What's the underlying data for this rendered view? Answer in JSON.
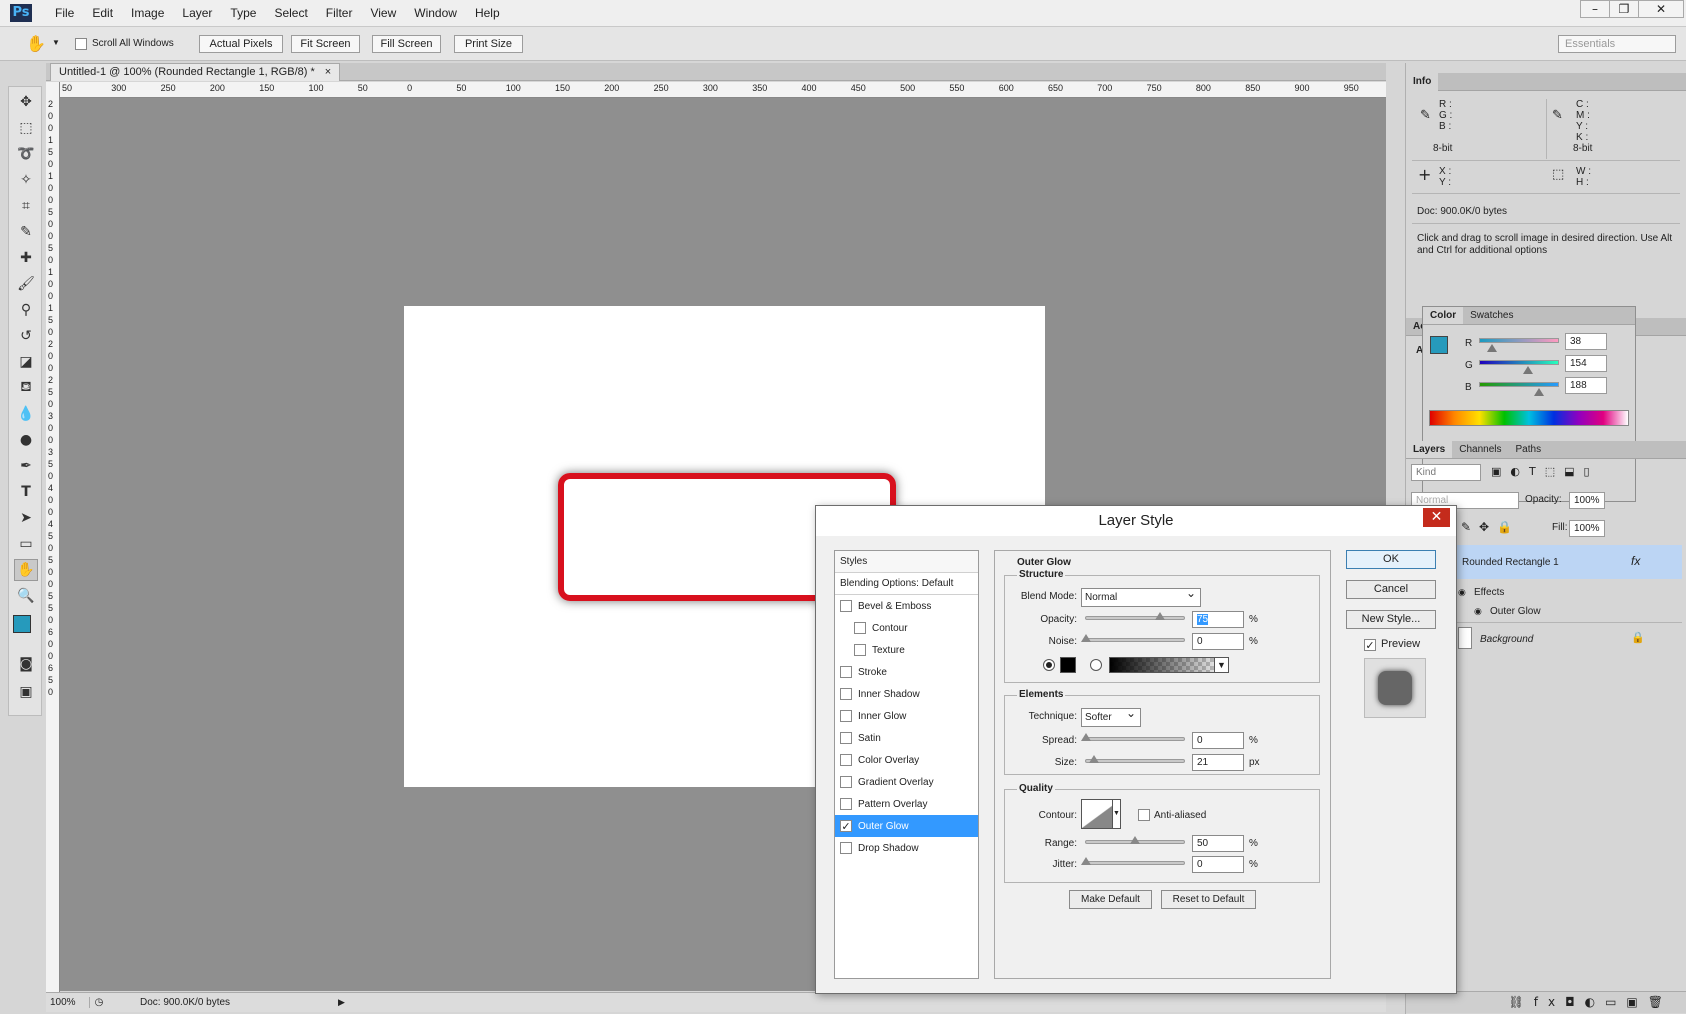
{
  "app": {
    "logo": "Ps"
  },
  "menu": [
    "File",
    "Edit",
    "Image",
    "Layer",
    "Type",
    "Select",
    "Filter",
    "View",
    "Window",
    "Help"
  ],
  "window_controls": {
    "minimize": "–",
    "restore": "❐",
    "close": "✕"
  },
  "options_bar": {
    "scroll_all_label": "Scroll All Windows",
    "buttons": [
      "Actual Pixels",
      "Fit Screen",
      "Fill Screen",
      "Print Size"
    ],
    "workspace": "Essentials"
  },
  "document": {
    "tab_title": "Untitled-1 @ 100% (Rounded Rectangle 1, RGB/8) *",
    "tab_close": "×",
    "ruler_h": [
      "50",
      "300",
      "250",
      "200",
      "150",
      "100",
      "50",
      "0",
      "50",
      "100",
      "150",
      "200",
      "250",
      "300",
      "350",
      "400",
      "450",
      "500",
      "550",
      "600",
      "650",
      "700",
      "750",
      "800",
      "850",
      "900",
      "950"
    ],
    "ruler_v": [
      "2",
      "0",
      "0",
      "1",
      "5",
      "0",
      "1",
      "0",
      "0",
      "5",
      "0",
      "0",
      "5",
      "0",
      "1",
      "0",
      "0",
      "1",
      "5",
      "0",
      "2",
      "0",
      "0",
      "2",
      "5",
      "0",
      "3",
      "0",
      "0",
      "3",
      "5",
      "0",
      "4",
      "0",
      "0",
      "4",
      "5",
      "0",
      "5",
      "0",
      "0",
      "5",
      "5",
      "0",
      "6",
      "0",
      "0",
      "6",
      "5",
      "0"
    ],
    "zoom": "100%",
    "doc_size": "Doc: 900.0K/0 bytes"
  },
  "info_panel": {
    "tab": "Info",
    "rgb_labels": "R :\nG :\nB :",
    "cmyk_labels": "C :\nM :\nY :\nK :",
    "bit_left": "8-bit",
    "bit_right": "8-bit",
    "xy_labels": "X :\nY :",
    "wh_labels": "W :\nH :",
    "doc_size": "Doc: 900.0K/0 bytes",
    "hint": "Click and drag to scroll image in desired direction.  Use Alt and Ctrl for additional options"
  },
  "color_panel": {
    "tabs": [
      "Color",
      "Swatches"
    ],
    "side_tab": "Ac",
    "side_label": "A",
    "channels": [
      {
        "name": "R",
        "value": "38",
        "level": 0.15
      },
      {
        "name": "G",
        "value": "154",
        "level": 0.6
      },
      {
        "name": "B",
        "value": "188",
        "level": 0.74
      }
    ],
    "fg": "#269abc"
  },
  "layers_panel": {
    "tabs": [
      "Layers",
      "Channels",
      "Paths"
    ],
    "kind": "Kind",
    "blend": "Normal",
    "opacity_label": "Opacity:",
    "opacity": "100%",
    "fill_label": "Fill:",
    "fill": "100%",
    "layers": [
      {
        "name": "Rounded Rectangle 1",
        "fx": "fx"
      },
      {
        "name": "Effects"
      },
      {
        "name": "Outer Glow"
      },
      {
        "name": "Background"
      }
    ]
  },
  "dialog": {
    "title": "Layer Style",
    "close": "✕",
    "styles_header": "Styles",
    "blending": "Blending Options: Default",
    "items": [
      {
        "label": "Bevel & Emboss",
        "checked": false,
        "sub": false
      },
      {
        "label": "Contour",
        "checked": false,
        "sub": true
      },
      {
        "label": "Texture",
        "checked": false,
        "sub": true
      },
      {
        "label": "Stroke",
        "checked": false,
        "sub": false
      },
      {
        "label": "Inner Shadow",
        "checked": false,
        "sub": false
      },
      {
        "label": "Inner Glow",
        "checked": false,
        "sub": false
      },
      {
        "label": "Satin",
        "checked": false,
        "sub": false
      },
      {
        "label": "Color Overlay",
        "checked": false,
        "sub": false
      },
      {
        "label": "Gradient Overlay",
        "checked": false,
        "sub": false
      },
      {
        "label": "Pattern Overlay",
        "checked": false,
        "sub": false
      },
      {
        "label": "Outer Glow",
        "checked": true,
        "sub": false,
        "selected": true
      },
      {
        "label": "Drop Shadow",
        "checked": false,
        "sub": false
      }
    ],
    "outer_glow": "Outer Glow",
    "structure": {
      "title": "Structure",
      "blend_mode_label": "Blend Mode:",
      "blend_mode": "Normal",
      "opacity_label": "Opacity:",
      "opacity": "75",
      "opacity_level": 0.75,
      "noise_label": "Noise:",
      "noise": "0",
      "noise_level": 0,
      "percent": "%"
    },
    "elements": {
      "title": "Elements",
      "technique_label": "Technique:",
      "technique": "Softer",
      "spread_label": "Spread:",
      "spread": "0",
      "spread_level": 0,
      "size_label": "Size:",
      "size": "21",
      "size_level": 0.084,
      "percent": "%",
      "px": "px"
    },
    "quality": {
      "title": "Quality",
      "contour_label": "Contour:",
      "anti_aliased": "Anti-aliased",
      "range_label": "Range:",
      "range": "50",
      "range_level": 0.5,
      "jitter_label": "Jitter:",
      "jitter": "0",
      "jitter_level": 0,
      "percent": "%"
    },
    "make_default": "Make Default",
    "reset_default": "Reset to Default",
    "ok": "OK",
    "cancel": "Cancel",
    "new_style": "New Style...",
    "preview": "Preview"
  }
}
